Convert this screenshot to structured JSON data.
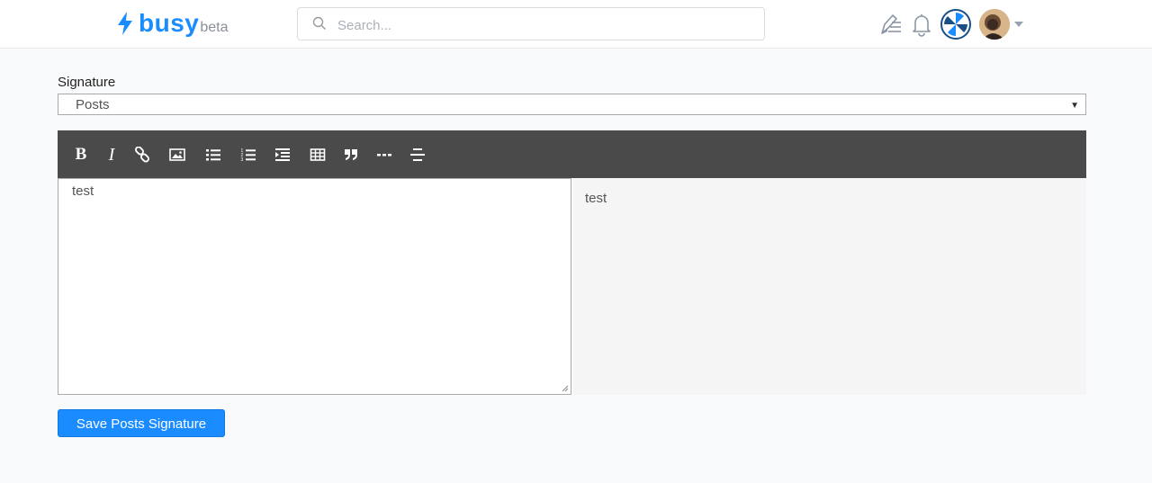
{
  "header": {
    "logo": {
      "name": "busy",
      "tag": "beta",
      "icon": "bolt-icon"
    },
    "search": {
      "placeholder": "Search..."
    },
    "icons": [
      "write-icon",
      "bell-icon",
      "account-avatar-icon",
      "user-avatar",
      "chevron-down-icon"
    ]
  },
  "form": {
    "label": "Signature",
    "select": {
      "value": "Posts"
    },
    "toolbar": {
      "bold": "B",
      "italic": "I",
      "items": [
        "bold-icon",
        "italic-icon",
        "link-icon",
        "image-icon",
        "bullet-list-icon",
        "numbered-list-icon",
        "indent-icon",
        "table-icon",
        "quote-icon",
        "horizontal-rule-icon",
        "center-align-icon"
      ]
    },
    "editor": {
      "value": "test"
    },
    "preview": {
      "text": "test"
    },
    "save_label": "Save Posts Signature"
  },
  "colors": {
    "brand": "#1a8cff",
    "toolbar_bg": "#4a4a4a",
    "page_bg": "#f9fafc",
    "preview_bg": "#f5f5f5"
  }
}
